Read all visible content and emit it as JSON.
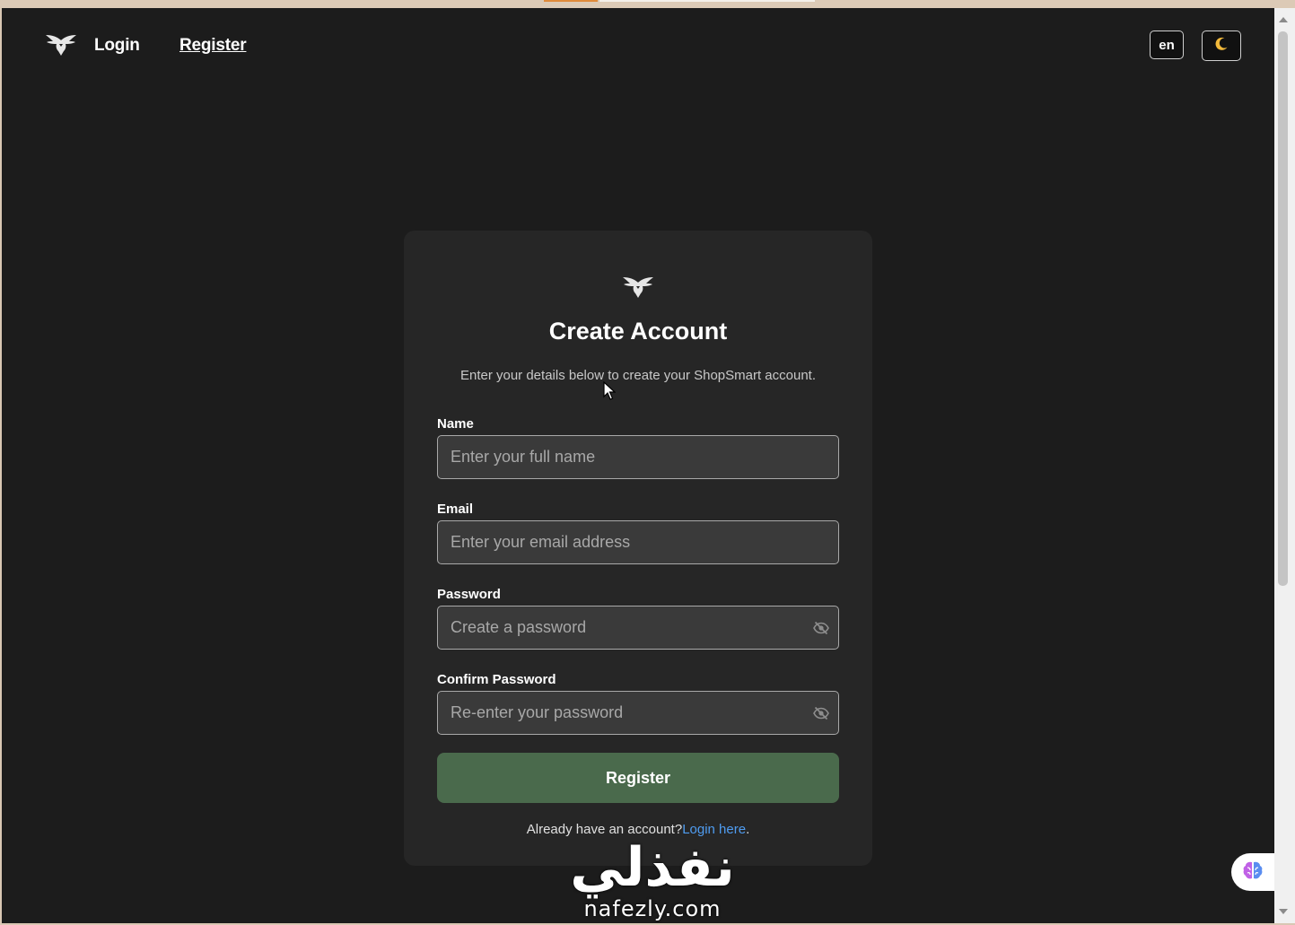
{
  "header": {
    "logo_icon": "eagle-logo-icon",
    "nav": {
      "login_label": "Login",
      "register_label": "Register"
    },
    "language_label": "en",
    "theme_icon": "moon-icon"
  },
  "card": {
    "logo_icon": "eagle-logo-icon",
    "title": "Create Account",
    "subtitle": "Enter your details below to create your ShopSmart account.",
    "fields": {
      "name": {
        "label": "Name",
        "value": "",
        "placeholder": "Enter your full name"
      },
      "email": {
        "label": "Email",
        "value": "",
        "placeholder": "Enter your email address"
      },
      "password": {
        "label": "Password",
        "value": "",
        "placeholder": "Create a password",
        "toggle_icon": "eye-slash-icon"
      },
      "confirm_password": {
        "label": "Confirm Password",
        "value": "",
        "placeholder": "Re-enter your password",
        "toggle_icon": "eye-slash-icon"
      }
    },
    "submit_label": "Register",
    "login_prompt": {
      "text": "Already have an account?",
      "link_label": "Login here",
      "suffix": "."
    }
  },
  "watermark": {
    "arabic": "نفذلي",
    "latin": "nafezly.com"
  },
  "floating_button_icon": "brain-icon",
  "colors": {
    "page_background": "#1c1c1c",
    "card_background": "#262626",
    "input_background": "#3a3a3a",
    "submit_button": "#4a6a4c",
    "link": "#4f9cf0"
  }
}
